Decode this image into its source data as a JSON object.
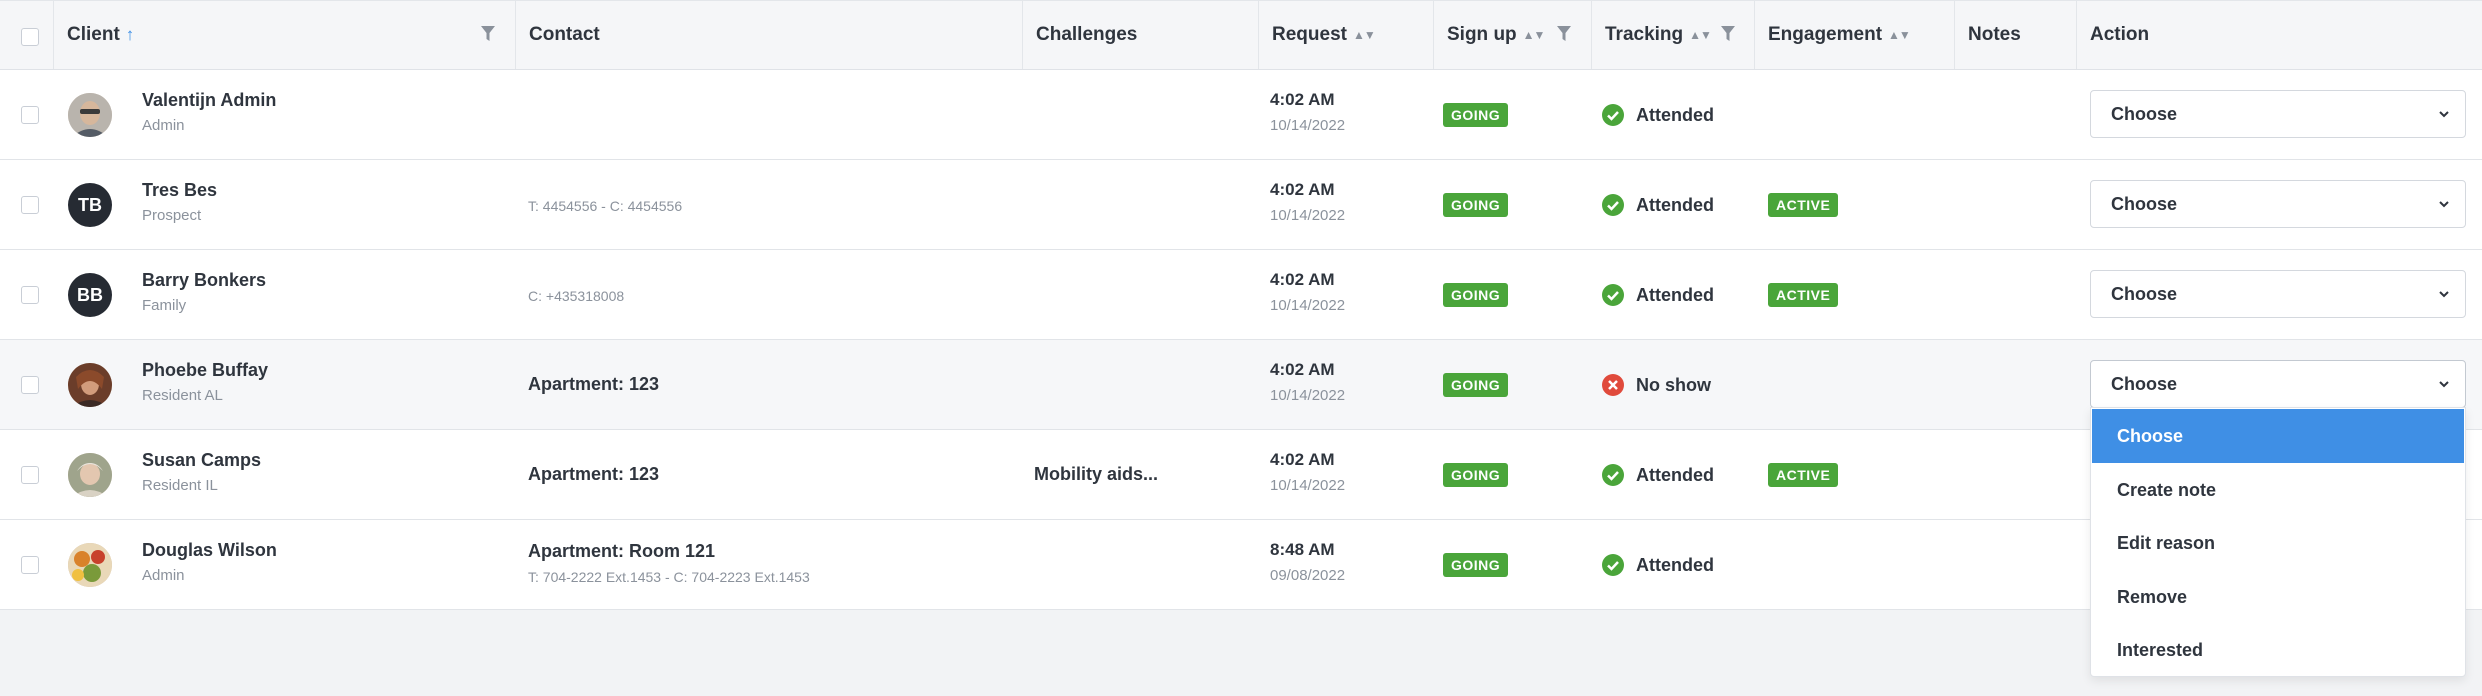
{
  "headers": {
    "client": "Client",
    "contact": "Contact",
    "challenges": "Challenges",
    "request": "Request",
    "signup": "Sign up",
    "tracking": "Tracking",
    "engagement": "Engagement",
    "notes": "Notes",
    "action": "Action"
  },
  "colors": {
    "badge_green": "#4aa53a",
    "attended_green": "#4aa53a",
    "noshow_red": "#e04a3c",
    "dropdown_selected": "#3f8fe5"
  },
  "rows": [
    {
      "name": "Valentijn Admin",
      "role": "Admin",
      "avatar": "photo",
      "contact_main": "",
      "contact_sub": "",
      "challenges": "",
      "time": "4:02 AM",
      "date": "10/14/2022",
      "signup": "GOING",
      "tracking": "Attended",
      "tracking_icon": "check-circle-icon",
      "engagement": "",
      "action": "Choose"
    },
    {
      "name": "Tres Bes",
      "role": "Prospect",
      "avatar": "initials",
      "initials": "TB",
      "contact_main": "",
      "contact_sub": "T: 4454556 - C: 4454556",
      "challenges": "",
      "time": "4:02 AM",
      "date": "10/14/2022",
      "signup": "GOING",
      "tracking": "Attended",
      "tracking_icon": "check-circle-icon",
      "engagement": "ACTIVE",
      "action": "Choose"
    },
    {
      "name": "Barry Bonkers",
      "role": "Family",
      "avatar": "initials",
      "initials": "BB",
      "contact_main": "",
      "contact_sub": "C: +435318008",
      "challenges": "",
      "time": "4:02 AM",
      "date": "10/14/2022",
      "signup": "GOING",
      "tracking": "Attended",
      "tracking_icon": "check-circle-icon",
      "engagement": "ACTIVE",
      "action": "Choose"
    },
    {
      "name": "Phoebe Buffay",
      "role": "Resident AL",
      "avatar": "photo",
      "contact_main": "Apartment: 123",
      "contact_sub": "",
      "challenges": "",
      "time": "4:02 AM",
      "date": "10/14/2022",
      "signup": "GOING",
      "tracking": "No show",
      "tracking_icon": "x-circle-icon",
      "engagement": "",
      "action": "Choose"
    },
    {
      "name": "Susan Camps",
      "role": "Resident IL",
      "avatar": "photo",
      "contact_main": "Apartment: 123",
      "contact_sub": "",
      "challenges": "Mobility aids...",
      "time": "4:02 AM",
      "date": "10/14/2022",
      "signup": "GOING",
      "tracking": "Attended",
      "tracking_icon": "check-circle-icon",
      "engagement": "ACTIVE",
      "action": ""
    },
    {
      "name": "Douglas Wilson",
      "role": "Admin",
      "avatar": "photo",
      "contact_main": "Apartment: Room 121",
      "contact_sub": "T: 704-2222 Ext.1453 - C: 704-2223 Ext.1453",
      "challenges": "",
      "time": "8:48 AM",
      "date": "09/08/2022",
      "signup": "GOING",
      "tracking": "Attended",
      "tracking_icon": "check-circle-icon",
      "engagement": "",
      "action": ""
    }
  ],
  "dropdown": {
    "options": [
      "Choose",
      "Create note",
      "Edit reason",
      "Remove",
      "Interested"
    ],
    "selected": "Choose"
  }
}
